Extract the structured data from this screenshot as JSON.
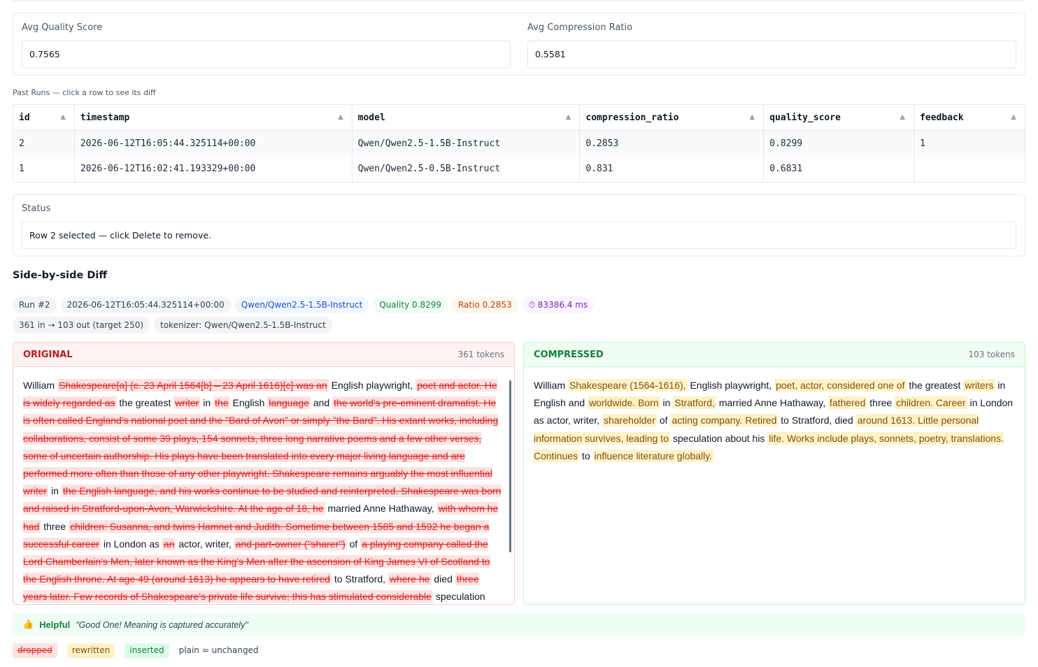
{
  "stats": {
    "quality_label": "Avg Quality Score",
    "quality_value": "0.7565",
    "ratio_label": "Avg Compression Ratio",
    "ratio_value": "0.5581"
  },
  "runs": {
    "caption": "Past Runs — click a row to see its diff",
    "sort_glyph": "▲",
    "columns": [
      "id",
      "timestamp",
      "model",
      "compression_ratio",
      "quality_score",
      "feedback"
    ],
    "rows": [
      [
        "2",
        "2026-06-12T16:05:44.325114+00:00",
        "Qwen/Qwen2.5-1.5B-Instruct",
        "0.2853",
        "0.8299",
        "1"
      ],
      [
        "1",
        "2026-06-12T16:02:41.193329+00:00",
        "Qwen/Qwen2.5-0.5B-Instruct",
        "0.831",
        "0.6831",
        ""
      ]
    ]
  },
  "status": {
    "label": "Status",
    "value": "Row 2 selected — click Delete to remove."
  },
  "diff": {
    "title": "Side-by-side Diff",
    "chips": {
      "run": "Run #2",
      "timestamp": "2026-06-12T16:05:44.325114+00:00",
      "model": "Qwen/Qwen2.5-1.5B-Instruct",
      "quality": "Quality 0.8299",
      "ratio": "Ratio 0.2853",
      "time": "⏱ 83386.4 ms",
      "tokens": "361 in → 103 out (target 250)",
      "tokenizer": "tokenizer: Qwen/Qwen2.5-1.5B-Instruct"
    },
    "original": {
      "title": "ORIGINAL",
      "count": "361 tokens",
      "segments": [
        {
          "t": "William ",
          "k": "plain"
        },
        {
          "t": "Shakespeare[a] (c. 23 April 1564[b] – 23 April 1616)[c] was an",
          "k": "dropped"
        },
        {
          "t": " English playwright, ",
          "k": "plain"
        },
        {
          "t": "poet and actor. He is widely regarded as",
          "k": "dropped"
        },
        {
          "t": " the greatest ",
          "k": "plain"
        },
        {
          "t": "writer",
          "k": "dropped"
        },
        {
          "t": " in ",
          "k": "plain"
        },
        {
          "t": "the",
          "k": "dropped"
        },
        {
          "t": " English ",
          "k": "plain"
        },
        {
          "t": "language",
          "k": "dropped"
        },
        {
          "t": " and ",
          "k": "plain"
        },
        {
          "t": "the world's pre-eminent dramatist. He is often called England's national poet and the \"Bard of Avon\" or simply \"the Bard\". His extant works, including collaborations, consist of some 39 plays, 154 sonnets, three long narrative poems and a few other verses, some of uncertain authorship. His plays have been translated into every major living language and are performed more often than those of any other playwright. Shakespeare remains arguably the most influential writer",
          "k": "dropped"
        },
        {
          "t": " in ",
          "k": "plain"
        },
        {
          "t": " the English language, and his works continue to be studied and reinterpreted. Shakespeare was born and raised in Stratford-upon-Avon, Warwickshire. At the age of 18, he",
          "k": "dropped"
        },
        {
          "t": " married Anne Hathaway, ",
          "k": "plain"
        },
        {
          "t": "with whom he had",
          "k": "dropped"
        },
        {
          "t": " three ",
          "k": "plain"
        },
        {
          "t": "children: Susanna, and twins Hamnet and Judith. Sometime between 1585 and 1592 he began a successful career",
          "k": "dropped"
        },
        {
          "t": " in London as ",
          "k": "plain"
        },
        {
          "t": "an",
          "k": "dropped"
        },
        {
          "t": " actor, writer, ",
          "k": "plain"
        },
        {
          "t": "and part-owner (\"sharer\")",
          "k": "dropped"
        },
        {
          "t": " of ",
          "k": "plain"
        },
        {
          "t": "a playing company called the Lord Chamberlain's Men, later known as the King's Men after the ascension of King James VI of Scotland to the English throne. At age 49 (around 1613) he appears to have retired",
          "k": "dropped"
        },
        {
          "t": " to Stratford, ",
          "k": "plain"
        },
        {
          "t": "where he",
          "k": "dropped"
        },
        {
          "t": " died ",
          "k": "plain"
        },
        {
          "t": "three years later. Few records of Shakespeare's private life survive; this has stimulated considerable",
          "k": "dropped"
        },
        {
          "t": " speculation about",
          "k": "plain"
        }
      ]
    },
    "compressed": {
      "title": "COMPRESSED",
      "count": "103 tokens",
      "segments": [
        {
          "t": "William ",
          "k": "plain"
        },
        {
          "t": "Shakespeare (1564-1616),",
          "k": "rewritten"
        },
        {
          "t": " English playwright, ",
          "k": "plain"
        },
        {
          "t": "poet, actor, considered one of",
          "k": "rewritten"
        },
        {
          "t": " the greatest ",
          "k": "plain"
        },
        {
          "t": "writers",
          "k": "rewritten"
        },
        {
          "t": " in English and ",
          "k": "plain"
        },
        {
          "t": "worldwide. Born",
          "k": "rewritten"
        },
        {
          "t": " in ",
          "k": "plain"
        },
        {
          "t": "Stratford,",
          "k": "rewritten"
        },
        {
          "t": " married Anne Hathaway, ",
          "k": "plain"
        },
        {
          "t": "fathered",
          "k": "rewritten"
        },
        {
          "t": " three ",
          "k": "plain"
        },
        {
          "t": "children. Career",
          "k": "rewritten"
        },
        {
          "t": " in London as actor, writer, ",
          "k": "plain"
        },
        {
          "t": "shareholder",
          "k": "rewritten"
        },
        {
          "t": " of ",
          "k": "plain"
        },
        {
          "t": "acting company. Retired",
          "k": "rewritten"
        },
        {
          "t": " to Stratford, died ",
          "k": "plain"
        },
        {
          "t": "around 1613. Little personal information survives, leading to",
          "k": "rewritten"
        },
        {
          "t": " speculation about his ",
          "k": "plain"
        },
        {
          "t": "life. Works include plays, sonnets, poetry, translations. Continues",
          "k": "rewritten"
        },
        {
          "t": " to ",
          "k": "plain"
        },
        {
          "t": "influence literature globally.",
          "k": "rewritten"
        }
      ]
    }
  },
  "feedback": {
    "icon": "thumbs-up-icon",
    "icon_glyph": "👍",
    "label": "Helpful",
    "quote": "\"Good One! Meaning is captured accurately\""
  },
  "legend": {
    "dropped": "dropped",
    "rewritten": "rewritten",
    "inserted": "inserted",
    "plain": "plain = unchanged"
  },
  "colors": {
    "dropped_bg": "#fee2e2",
    "dropped_fg": "#dc2626",
    "rewritten_bg": "#fef3c7",
    "inserted_bg": "#dcfce7",
    "quality": "#15803d",
    "ratio": "#c2410c",
    "model": "#1d4ed8",
    "time": "#7e22ce"
  }
}
